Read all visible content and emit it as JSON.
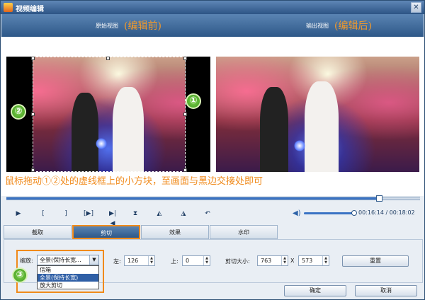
{
  "window": {
    "title": "视频编辑",
    "close_glyph": "✕"
  },
  "views": {
    "original_label": "原始视图",
    "original_sub": "(编辑前)",
    "output_label": "输出视图",
    "output_sub": "(编辑后)"
  },
  "badges": {
    "one": "①",
    "two": "②",
    "three": "③"
  },
  "hint": "鼠标拖动①②处的虚线框上的小方块，至画面与黑边交接处即可",
  "playback": {
    "progress_fraction": 0.9,
    "volume_fraction": 1.0,
    "time": "00:16:14 / 00:18:02",
    "controls": [
      {
        "name": "play-icon",
        "glyph": "▶"
      },
      {
        "name": "mark-in-icon",
        "glyph": "["
      },
      {
        "name": "mark-out-icon",
        "glyph": "]"
      },
      {
        "name": "play-segment-icon",
        "glyph": "[▶]"
      },
      {
        "name": "step-frame-icon",
        "glyph": "▶|◀"
      },
      {
        "name": "split-icon",
        "glyph": "⧗"
      },
      {
        "name": "rotate-left-icon",
        "glyph": "◭"
      },
      {
        "name": "rotate-right-icon",
        "glyph": "◮"
      },
      {
        "name": "undo-icon",
        "glyph": "↶"
      }
    ]
  },
  "tabs": [
    {
      "label": "截取",
      "active": false
    },
    {
      "label": "剪切",
      "active": true
    },
    {
      "label": "效果",
      "active": false
    },
    {
      "label": "水印",
      "active": false
    }
  ],
  "crop": {
    "zoom_label": "缩放:",
    "zoom_selected": "全景(保持长宽...",
    "zoom_options": [
      "信箱",
      "全景(保持长宽)",
      "放大剪切"
    ],
    "zoom_selected_index": 1,
    "left_label": "左:",
    "left_value": "126",
    "top_label": "上:",
    "top_value": "0",
    "size_label": "剪切大小:",
    "width_value": "763",
    "times": "X",
    "height_value": "573",
    "reset_label": "重置"
  },
  "footer": {
    "ok_label": "确定",
    "cancel_label": "取消"
  }
}
